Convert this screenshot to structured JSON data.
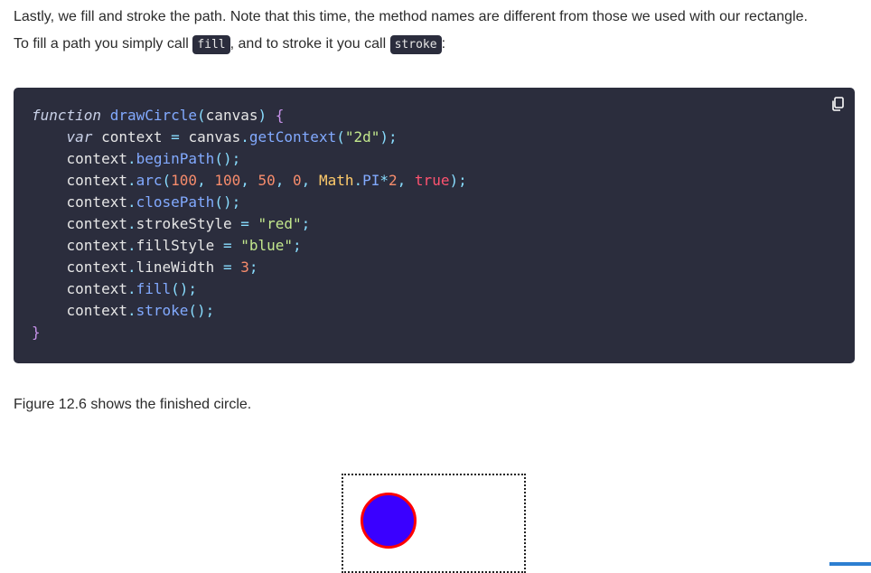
{
  "intro": {
    "line1": "Lastly, we fill and stroke the path. Note that this time, the method names are different from those we used with our rectangle.",
    "line2_prefix": "To fill a path you simply call ",
    "fill_code": "fill",
    "line2_middle": ", and to stroke it you call ",
    "stroke_code": "stroke",
    "line2_suffix": ":"
  },
  "code": {
    "copy_icon": "copy-icon",
    "line1": {
      "keyword": "function",
      "name": "drawCircle",
      "open": "(",
      "param": "canvas",
      "close": ")",
      "brace": "{"
    },
    "line2": {
      "keyword": "var",
      "var": "context",
      "eq": "=",
      "obj": "canvas",
      "dot": ".",
      "method": "getContext",
      "open": "(",
      "arg": "\"2d\"",
      "close": ");"
    },
    "line3": {
      "obj": "context",
      "dot": ".",
      "method": "beginPath",
      "call": "();"
    },
    "line4": {
      "obj": "context",
      "dot": ".",
      "method": "arc",
      "open": "(",
      "a1": "100",
      "c1": ", ",
      "a2": "100",
      "c2": ", ",
      "a3": "50",
      "c3": ", ",
      "a4": "0",
      "c4": ", ",
      "math": "Math",
      "dot2": ".",
      "pi": "PI",
      "mul": "*",
      "two": "2",
      "c5": ", ",
      "bool": "true",
      "close": ");"
    },
    "line5": {
      "obj": "context",
      "dot": ".",
      "method": "closePath",
      "call": "();"
    },
    "line6": {
      "obj": "context",
      "dot": ".",
      "prop": "strokeStyle",
      "eq": "=",
      "val": "\"red\"",
      "semi": ";"
    },
    "line7": {
      "obj": "context",
      "dot": ".",
      "prop": "fillStyle",
      "eq": "=",
      "val": "\"blue\"",
      "semi": ";"
    },
    "line8": {
      "obj": "context",
      "dot": ".",
      "prop": "lineWidth",
      "eq": "=",
      "val": "3",
      "semi": ";"
    },
    "line9": {
      "obj": "context",
      "dot": ".",
      "method": "fill",
      "call": "();"
    },
    "line10": {
      "obj": "context",
      "dot": ".",
      "method": "stroke",
      "call": "();"
    },
    "line11": {
      "brace": "}"
    }
  },
  "caption": "Figure 12.6 shows the finished circle.",
  "figure": {
    "fill_color": "#3a00ff",
    "stroke_color": "#ff0000"
  },
  "colors": {
    "code_bg": "#2b2d3d",
    "text": "#2b2b2b",
    "accent": "#2d7fd1"
  }
}
